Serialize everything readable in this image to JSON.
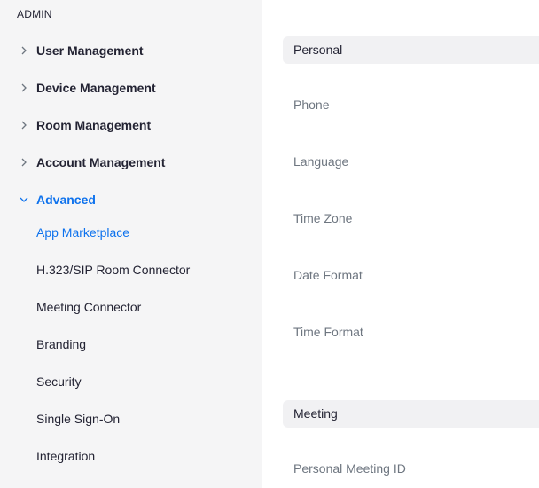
{
  "sidebar": {
    "section_title": "ADMIN",
    "items": [
      {
        "label": "User Management"
      },
      {
        "label": "Device Management"
      },
      {
        "label": "Room Management"
      },
      {
        "label": "Account Management"
      },
      {
        "label": "Advanced"
      }
    ],
    "sub_items": [
      {
        "label": "App Marketplace"
      },
      {
        "label": "H.323/SIP Room Connector"
      },
      {
        "label": "Meeting Connector"
      },
      {
        "label": "Branding"
      },
      {
        "label": "Security"
      },
      {
        "label": "Single Sign-On"
      },
      {
        "label": "Integration"
      }
    ]
  },
  "main": {
    "personal_header": "Personal",
    "personal_fields": [
      "Phone",
      "Language",
      "Time Zone",
      "Date Format",
      "Time Format"
    ],
    "meeting_header": "Meeting",
    "meeting_fields": [
      "Personal Meeting ID"
    ]
  },
  "colors": {
    "accent": "#0e72ed",
    "text": "#232333",
    "muted": "#6e7680",
    "sidebar_bg": "#f5f5f6"
  }
}
